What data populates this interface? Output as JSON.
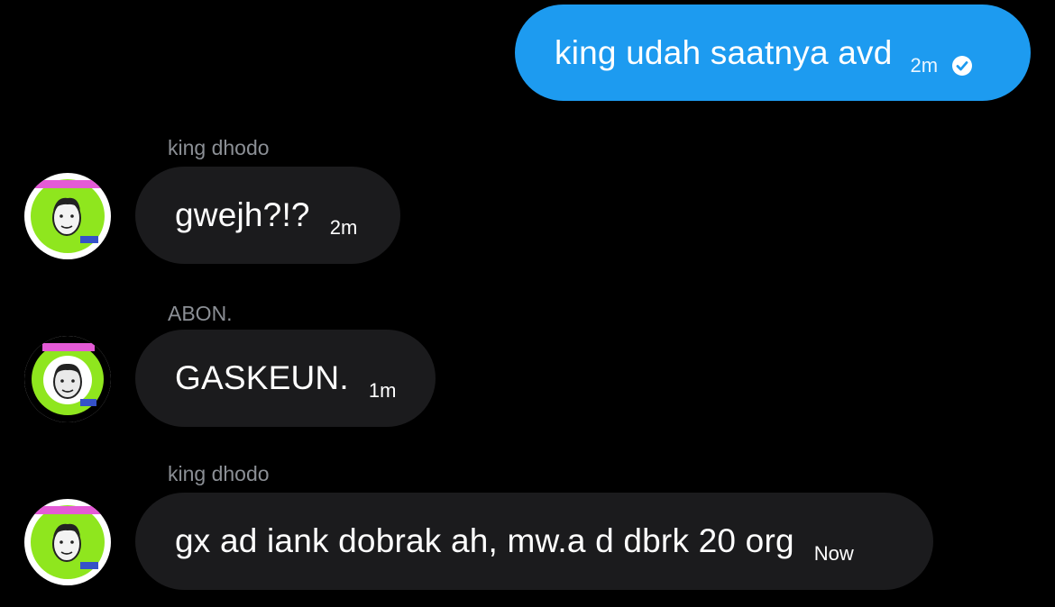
{
  "conversation": {
    "messages": [
      {
        "direction": "outgoing",
        "sender": "",
        "text": "king udah saatnya avd",
        "time": "2m",
        "status_icon": "check-circle-icon"
      },
      {
        "direction": "incoming",
        "sender": "king dhodo",
        "text": "gwejh?!?",
        "time": "2m",
        "avatar_icon": "avatar-king-dhodo"
      },
      {
        "direction": "incoming",
        "sender": "ABON.",
        "text": "GASKEUN.",
        "time": "1m",
        "avatar_icon": "avatar-abon"
      },
      {
        "direction": "incoming",
        "sender": "king dhodo",
        "text": "gx ad iank dobrak ah, mw.a d dbrk 20 org",
        "time": "Now",
        "avatar_icon": "avatar-king-dhodo"
      }
    ]
  },
  "colors": {
    "background": "#000000",
    "outgoing_bubble": "#1d9bf0",
    "incoming_bubble": "#1b1b1d",
    "sender_name": "#8b8f95",
    "avatar_green": "#8fe61e",
    "avatar_banner": "#e45ad6"
  }
}
